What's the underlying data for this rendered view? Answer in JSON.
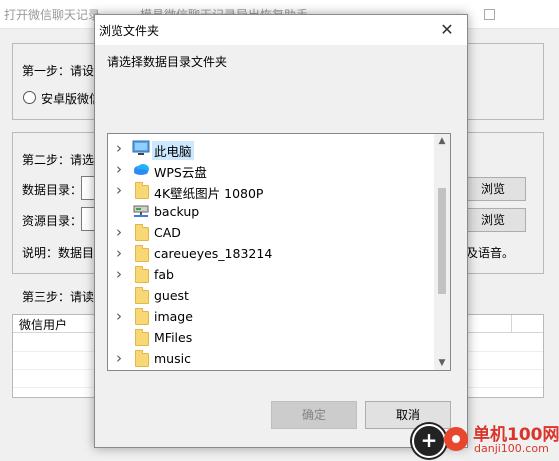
{
  "main_window": {
    "title": "打开微信聊天记录",
    "title_right": "模具微信聊天记录导出恢复助手",
    "step1_label": "第一步：请设",
    "android_option": "安卓版微信",
    "step2_label": "第二步：请选",
    "data_dir_label": "数据目录：",
    "res_dir_label": "资源目录：",
    "browse_label": "浏览",
    "note_label": "说明：数据目",
    "note_tail": "及语音。",
    "step3_label": "第三步：请读",
    "list_header": "微信用户"
  },
  "dialog": {
    "title": "浏览文件夹",
    "close_glyph": "✕",
    "prompt": "请选择数据目录文件夹",
    "tree": [
      {
        "label": "此电脑",
        "icon": "computer-icon",
        "expandable": true,
        "selected": true
      },
      {
        "label": "WPS云盘",
        "icon": "cloud-icon",
        "expandable": true,
        "selected": false
      },
      {
        "label": "4K壁纸图片 1080P",
        "icon": "folder-icon",
        "expandable": true,
        "selected": false
      },
      {
        "label": "backup",
        "icon": "network-drive-icon",
        "expandable": false,
        "selected": false
      },
      {
        "label": "CAD",
        "icon": "folder-icon",
        "expandable": true,
        "selected": false
      },
      {
        "label": "careueyes_183214",
        "icon": "folder-icon",
        "expandable": true,
        "selected": false
      },
      {
        "label": "fab",
        "icon": "folder-icon",
        "expandable": true,
        "selected": false
      },
      {
        "label": "guest",
        "icon": "folder-icon",
        "expandable": false,
        "selected": false
      },
      {
        "label": "image",
        "icon": "folder-icon",
        "expandable": true,
        "selected": false
      },
      {
        "label": "MFiles",
        "icon": "folder-icon",
        "expandable": false,
        "selected": false
      },
      {
        "label": "music",
        "icon": "folder-icon",
        "expandable": true,
        "selected": false
      }
    ],
    "ok_label": "确定",
    "cancel_label": "取消"
  },
  "watermark": {
    "name": "单机100网",
    "url": "danji100.com"
  },
  "colors": {
    "selection": "#cce8ff",
    "watermark": "#d9352a"
  }
}
